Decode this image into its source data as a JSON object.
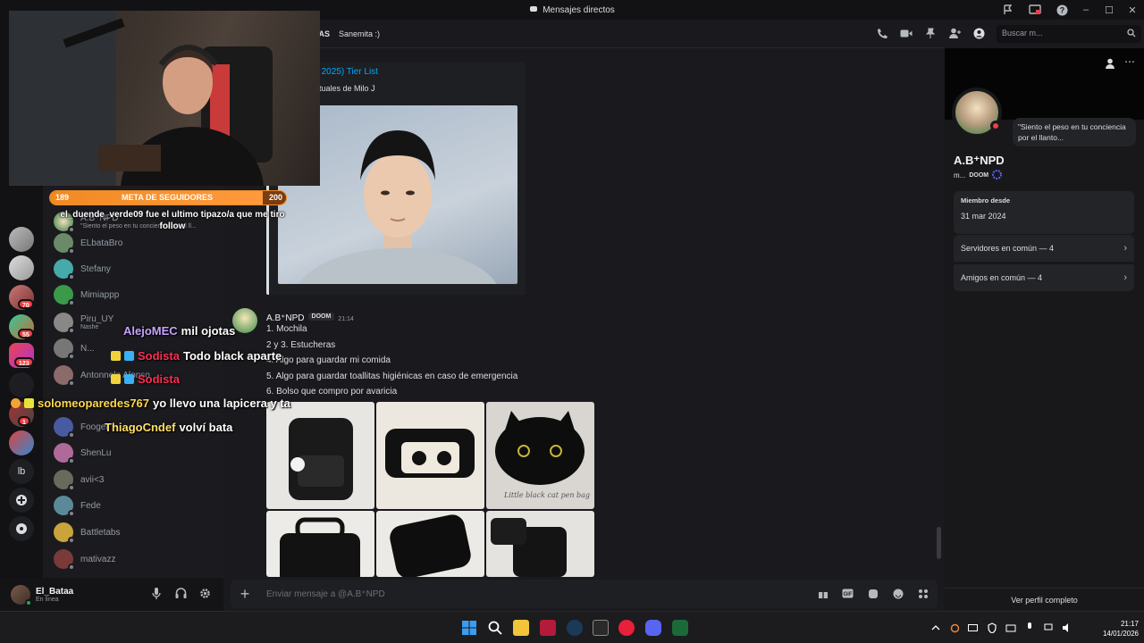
{
  "window": {
    "title": "Mensajes directos"
  },
  "header": {
    "tabs": [
      "ÍAS",
      "Sanemita :)"
    ],
    "search_placeholder": "Buscar m..."
  },
  "servers": {
    "badges": [
      "70",
      "55",
      "123",
      "1"
    ],
    "text_icon": "lb"
  },
  "dm_list": {
    "items": [
      {
        "name": "A.B⁺NPD",
        "sub": "\"Siento el peso en tu conciencia por el ll..."
      },
      {
        "name": "ELbataBro",
        "sub": ""
      },
      {
        "name": "Stefany",
        "sub": ""
      },
      {
        "name": "Mimiappp",
        "sub": ""
      },
      {
        "name": "Piru_UY",
        "sub": "Nashe"
      },
      {
        "name": "N...",
        "sub": ""
      },
      {
        "name": "Antonnela Alonso",
        "sub": ""
      },
      {
        "name": "",
        "sub": ""
      },
      {
        "name": "Fooger",
        "sub": ""
      },
      {
        "name": "ShenLu",
        "sub": ""
      },
      {
        "name": "avii<3",
        "sub": ""
      },
      {
        "name": "Fede",
        "sub": ""
      },
      {
        "name": "Battletabs",
        "sub": ""
      },
      {
        "name": "mativazz",
        "sub": ""
      }
    ]
  },
  "user": {
    "name": "El_Bataa",
    "status": "En línea"
  },
  "embed": {
    "title": "ilo J (Junio 2025) Tier List",
    "description": "anciones actuales de Milo J"
  },
  "message": {
    "author": "A.B⁺NPD",
    "tag": "DOOM",
    "time": "21:14",
    "lines": [
      "1. Mochila",
      "2 y 3. Estucheras",
      "4. Algo para guardar mi comida",
      "5. Algo para guardar toallitas higiénicas en caso de emergencia",
      "6. Bolso que compro por avaricia"
    ],
    "photo_caption": "Little black cat pen bag"
  },
  "composer": {
    "placeholder": "Enviar mensaje a @A.B⁺NPD"
  },
  "profile": {
    "status_bubble": "\"Siento el peso en tu conciencia por el llanto...",
    "display_name": "A.B⁺NPD",
    "username_short": "m...",
    "tag": "DOOM",
    "member_since_label": "Miembro desde",
    "member_since": "31 mar 2024",
    "mutual_servers": "Servidores en común — 4",
    "mutual_friends": "Amigos en común — 4",
    "view_full": "Ver perfil completo"
  },
  "stream": {
    "goal": {
      "label": "META DE SEGUIDORES",
      "current": "189",
      "target": "200",
      "progress": 0.9
    },
    "follow_message": "el_duende_verde09 fue el ultimo tipazo/a que me tiro follow",
    "chat": [
      {
        "user": "AlejoMEC",
        "msg": "mil ojotas",
        "color": "#c6a2ff"
      },
      {
        "user": "Sodista",
        "msg": "Todo black aparte",
        "color": "#ff2d55"
      },
      {
        "user": "Sodista",
        "msg": "",
        "color": "#ff2d55"
      },
      {
        "user": "solomeoparedes767",
        "msg": "yo llevo una lapicera y ta",
        "color": "#ffd84d"
      },
      {
        "user": "ThiagoCndef",
        "msg": "volví bata",
        "color": "#ffe066"
      }
    ]
  },
  "taskbar": {
    "time": "21:17",
    "date": "14/01/2026"
  },
  "colors": {
    "accent": "#5865f2",
    "online": "#23a55a",
    "dnd": "#f23f42",
    "link": "#00a8fc",
    "goal": "#f08a24"
  }
}
